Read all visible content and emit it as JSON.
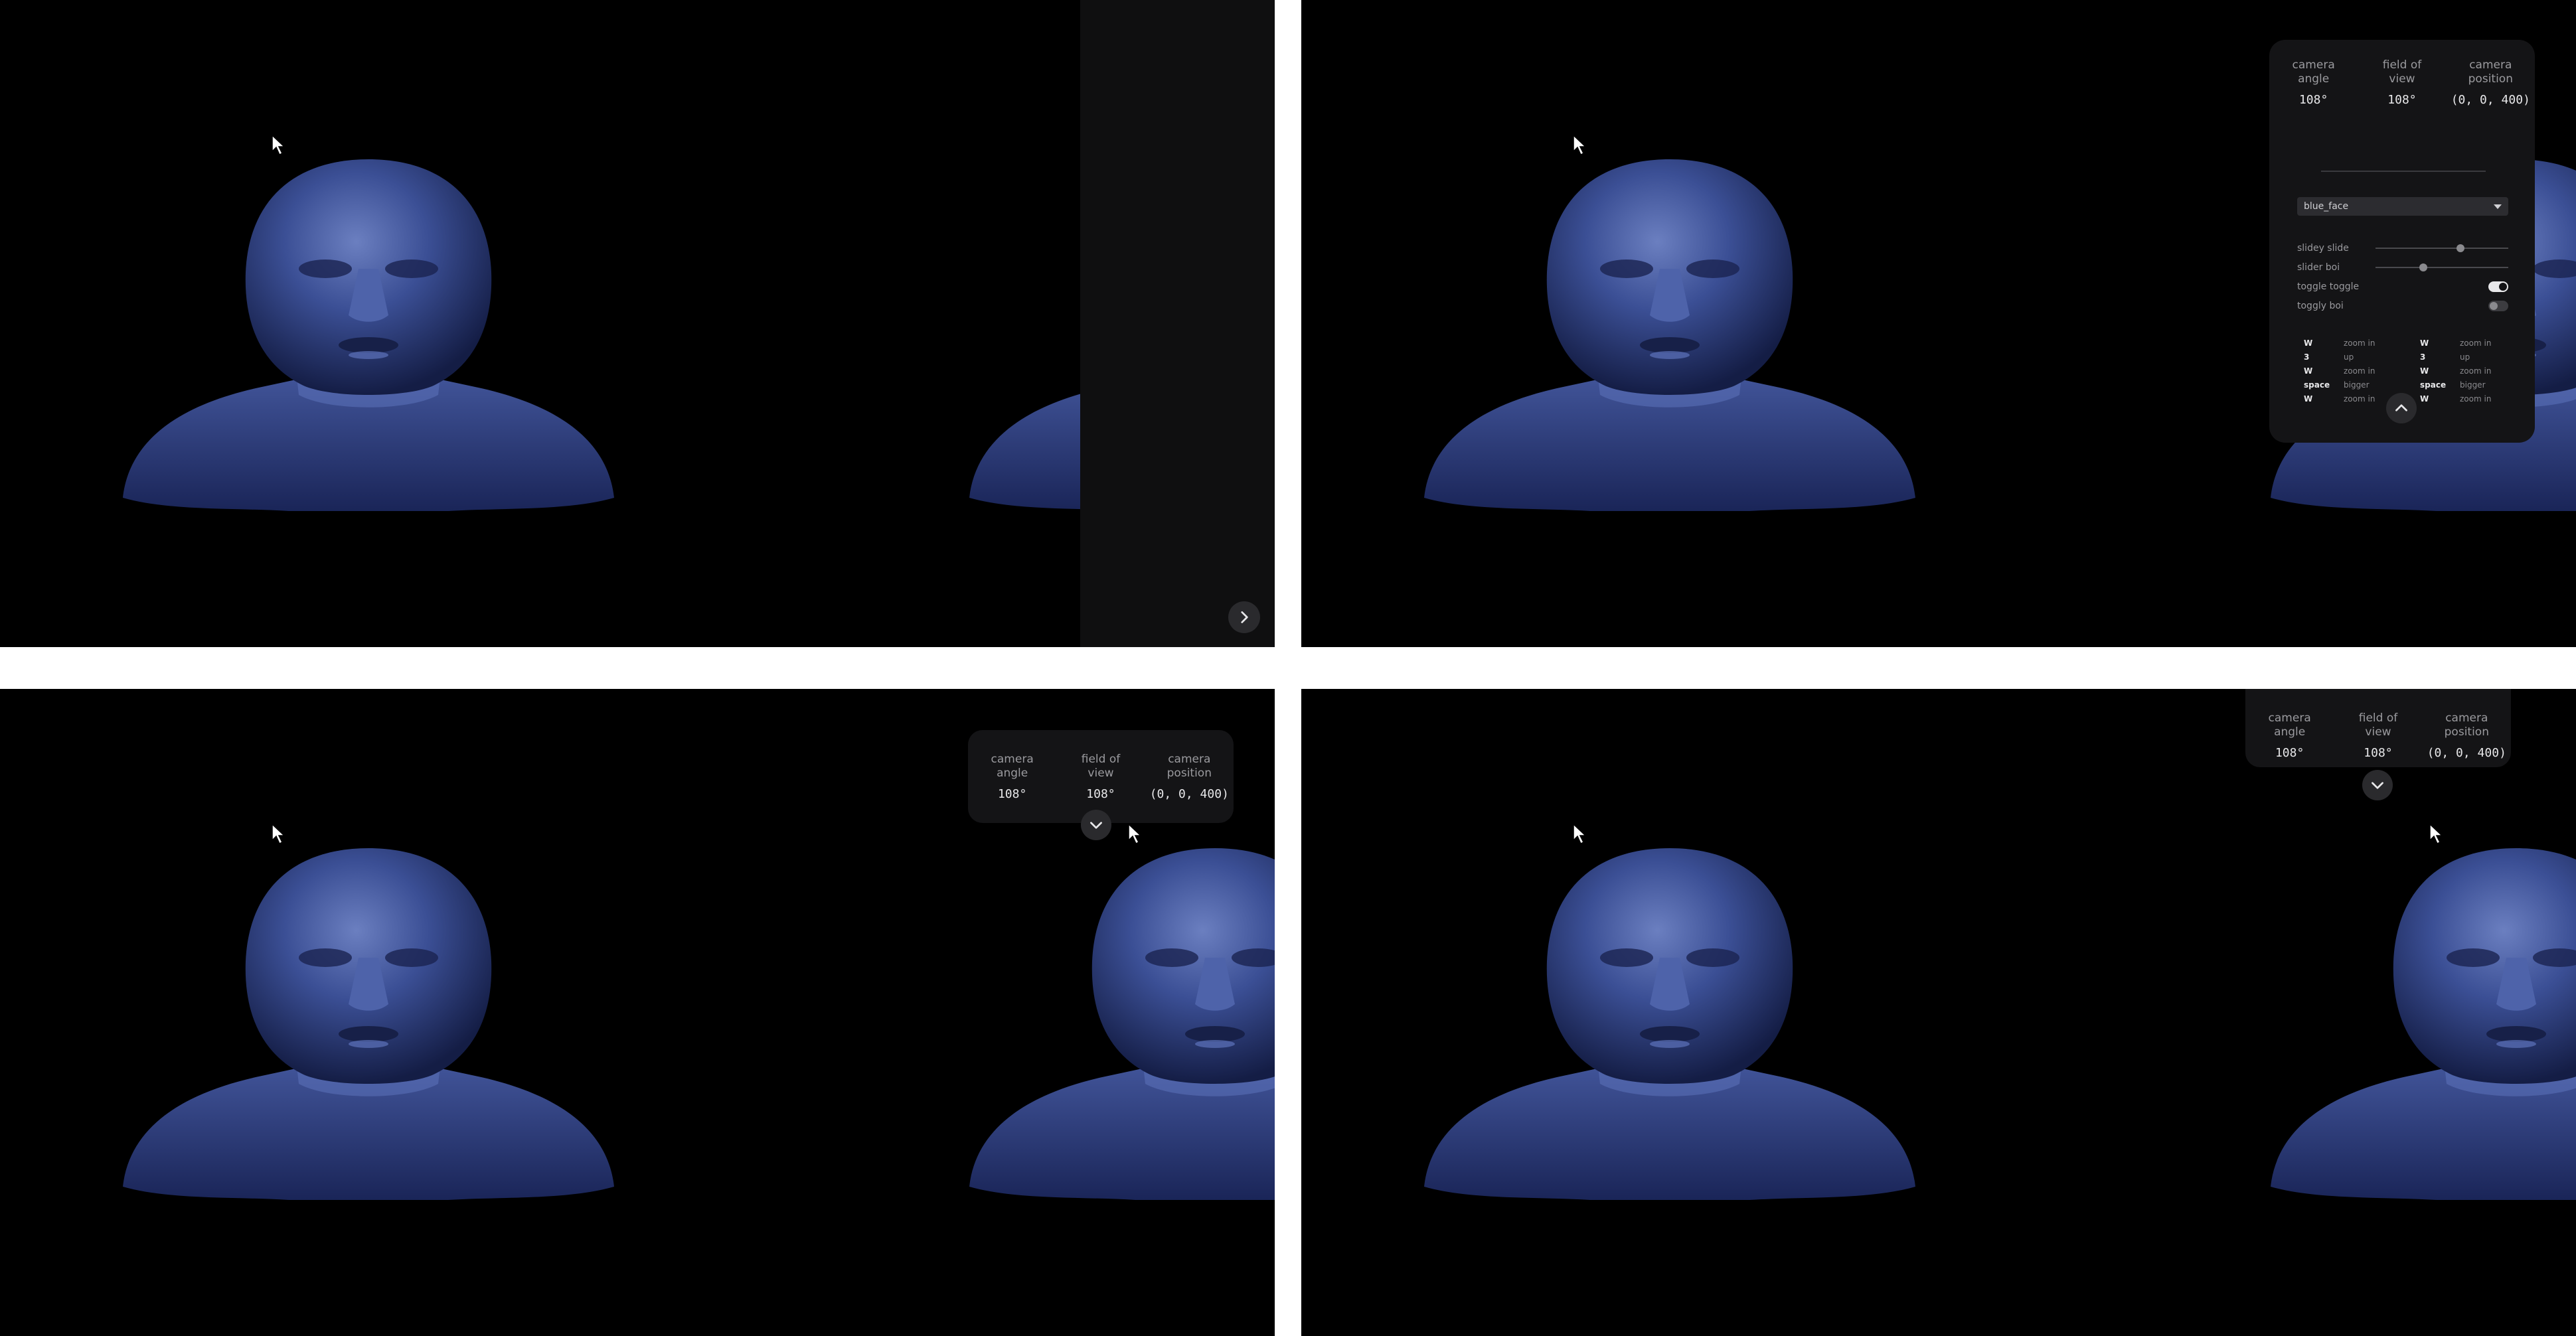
{
  "info": {
    "camera_angle_label": "camera\nangle",
    "field_of_view_label": "field of\nview",
    "camera_position_label": "camera\nposition",
    "camera_angle_value": "108°",
    "field_of_view_value": "108°",
    "camera_position_value": "(0, 0, 400)"
  },
  "settings": {
    "dropdown_value": "blue_face",
    "slider1_label": "slidey slide",
    "slider1_value": 0.65,
    "slider2_label": "slider boi",
    "slider2_value": 0.35,
    "toggle1_label": "toggle toggle",
    "toggle1_on": true,
    "toggle2_label": "toggly boi",
    "toggle2_on": false,
    "keys_left": [
      {
        "key": "W",
        "action": "zoom in"
      },
      {
        "key": "3",
        "action": "up"
      },
      {
        "key": "W",
        "action": "zoom in"
      },
      {
        "key": "space",
        "action": "bigger"
      },
      {
        "key": "W",
        "action": "zoom in"
      }
    ],
    "keys_right": [
      {
        "key": "W",
        "action": "zoom in"
      },
      {
        "key": "3",
        "action": "up"
      },
      {
        "key": "W",
        "action": "zoom in"
      },
      {
        "key": "space",
        "action": "bigger"
      },
      {
        "key": "W",
        "action": "zoom in"
      }
    ]
  },
  "icons": {
    "expand_panel": "chevron-right-icon",
    "collapse_settings": "chevron-up-icon",
    "expand_info": "chevron-down-icon",
    "cursor": "mouse-pointer-icon"
  },
  "colors": {
    "background": "#000000",
    "panel": "#141416",
    "bust_blue": "#3a4f8f"
  }
}
